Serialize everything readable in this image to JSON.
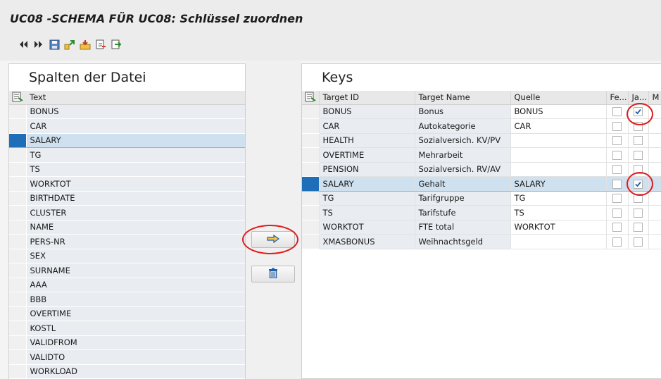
{
  "window": {
    "title": "UC08 -SCHEMA FÜR UC08: Schlüssel zuordnen"
  },
  "toolbar": {
    "icons": [
      "double-left-arrow-icon",
      "double-right-arrow-icon",
      "save-icon",
      "import-icon",
      "export-icon",
      "copy-icon",
      "paste-icon"
    ]
  },
  "left": {
    "title": "Spalten der Datei",
    "column_header": "Text",
    "selected_row": "SALARY",
    "rows": [
      "BONUS",
      "CAR",
      "SALARY",
      "TG",
      "TS",
      "WORKTOT",
      "BIRTHDATE",
      "CLUSTER",
      "NAME",
      "PERS-NR",
      "SEX",
      "SURNAME",
      "AAA",
      "BBB",
      "OVERTIME",
      "KOSTL",
      "VALIDFROM",
      "VALIDTO",
      "WORKLOAD"
    ]
  },
  "middle": {
    "assign_button_icon": "right-arrow-icon",
    "delete_button_icon": "trash-icon"
  },
  "right": {
    "title": "Keys",
    "columns": [
      "Target ID",
      "Target Name",
      "Quelle",
      "Fe...",
      "Ja...",
      "M"
    ],
    "selected_row": "SALARY",
    "rows": [
      {
        "target_id": "BONUS",
        "target_name": "Bonus",
        "quelle": "BONUS",
        "fe": false,
        "ja": true
      },
      {
        "target_id": "CAR",
        "target_name": "Autokategorie",
        "quelle": "CAR",
        "fe": false,
        "ja": false
      },
      {
        "target_id": "HEALTH",
        "target_name": "Sozialversich. KV/PV",
        "quelle": "",
        "fe": false,
        "ja": false
      },
      {
        "target_id": "OVERTIME",
        "target_name": "Mehrarbeit",
        "quelle": "",
        "fe": false,
        "ja": false
      },
      {
        "target_id": "PENSION",
        "target_name": "Sozialversich. RV/AV",
        "quelle": "",
        "fe": false,
        "ja": false
      },
      {
        "target_id": "SALARY",
        "target_name": "Gehalt",
        "quelle": "SALARY",
        "fe": false,
        "ja": true
      },
      {
        "target_id": "TG",
        "target_name": "Tarifgruppe",
        "quelle": "TG",
        "fe": false,
        "ja": false
      },
      {
        "target_id": "TS",
        "target_name": "Tarifstufe",
        "quelle": "TS",
        "fe": false,
        "ja": false
      },
      {
        "target_id": "WORKTOT",
        "target_name": "FTE total",
        "quelle": "WORKTOT",
        "fe": false,
        "ja": false
      },
      {
        "target_id": "XMASBONUS",
        "target_name": "Weihnachtsgeld",
        "quelle": "",
        "fe": false,
        "ja": false
      }
    ]
  },
  "colors": {
    "highlight_row": "#cfe0ee",
    "selection_marker": "#1f6fb8",
    "annotation": "#e01b1b",
    "check": "#1f5fa8"
  }
}
